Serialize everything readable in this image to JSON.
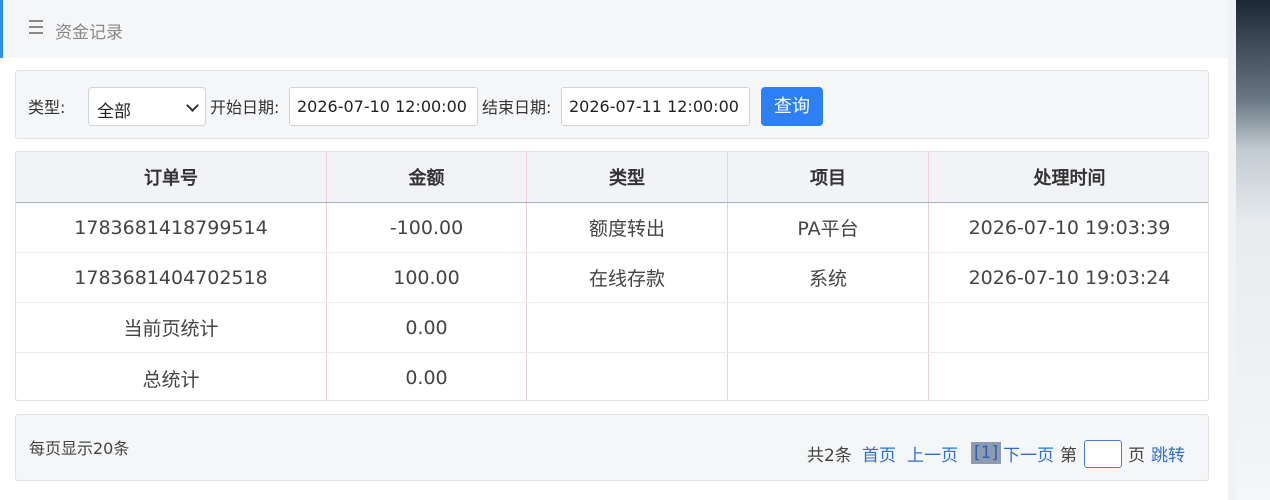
{
  "header": {
    "title": "资金记录"
  },
  "filter": {
    "type_label": "类型:",
    "type_selected": "全部",
    "start_label": "开始日期:",
    "start_value": "2026-07-10 12:00:00",
    "end_label": "结束日期:",
    "end_value": "2026-07-11 12:00:00",
    "query_label": "查询"
  },
  "table": {
    "headers": [
      "订单号",
      "金额",
      "类型",
      "项目",
      "处理时间"
    ],
    "rows": [
      [
        "1783681418799514",
        "-100.00",
        "额度转出",
        "PA平台",
        "2026-07-10 19:03:39"
      ],
      [
        "1783681404702518",
        "100.00",
        "在线存款",
        "系统",
        "2026-07-10 19:03:24"
      ],
      [
        "当前页统计",
        "0.00",
        "",
        "",
        ""
      ],
      [
        "总统计",
        "0.00",
        "",
        "",
        ""
      ]
    ]
  },
  "footer": {
    "per_page": "每页显示20条",
    "total": "共2条",
    "first": "首页",
    "prev": "上一页",
    "current": "[1]",
    "next": "下一页",
    "page_prefix": "第",
    "page_suffix": "页",
    "jump": "跳转"
  }
}
